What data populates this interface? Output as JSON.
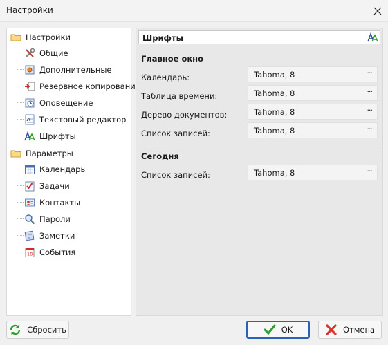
{
  "window": {
    "title": "Настройки"
  },
  "tree": {
    "groups": [
      {
        "label": "Настройки",
        "items": [
          {
            "label": "Общие",
            "icon": "tools-icon"
          },
          {
            "label": "Дополнительные",
            "icon": "advanced-settings-icon"
          },
          {
            "label": "Резервное копирование",
            "icon": "backup-icon"
          },
          {
            "label": "Оповещение",
            "icon": "notification-icon"
          },
          {
            "label": "Текстовый редактор",
            "icon": "text-editor-icon"
          },
          {
            "label": "Шрифты",
            "icon": "fonts-icon",
            "selected": true
          }
        ]
      },
      {
        "label": "Параметры",
        "items": [
          {
            "label": "Календарь",
            "icon": "calendar-icon"
          },
          {
            "label": "Задачи",
            "icon": "tasks-icon"
          },
          {
            "label": "Контакты",
            "icon": "contacts-icon"
          },
          {
            "label": "Пароли",
            "icon": "passwords-icon"
          },
          {
            "label": "Заметки",
            "icon": "notes-icon"
          },
          {
            "label": "События",
            "icon": "events-icon"
          }
        ]
      }
    ]
  },
  "panel": {
    "title": "Шрифты",
    "sections": [
      {
        "title": "Главное окно",
        "fields": [
          {
            "label": "Календарь:",
            "value": "Tahoma, 8"
          },
          {
            "label": "Таблица времени:",
            "value": "Tahoma, 8"
          },
          {
            "label": "Дерево документов:",
            "value": "Tahoma, 8"
          },
          {
            "label": "Список записей:",
            "value": "Tahoma, 8"
          }
        ]
      },
      {
        "title": "Сегодня",
        "fields": [
          {
            "label": "Список записей:",
            "value": "Tahoma, 8"
          }
        ]
      }
    ],
    "browse_label": "···"
  },
  "buttons": {
    "reset": "Сбросить",
    "ok": "OK",
    "cancel": "Отмена"
  },
  "colors": {
    "accent": "#2a62b8",
    "folder": "#f2c75c",
    "ok_check": "#2e9e2e",
    "cancel_x": "#d9342b"
  }
}
